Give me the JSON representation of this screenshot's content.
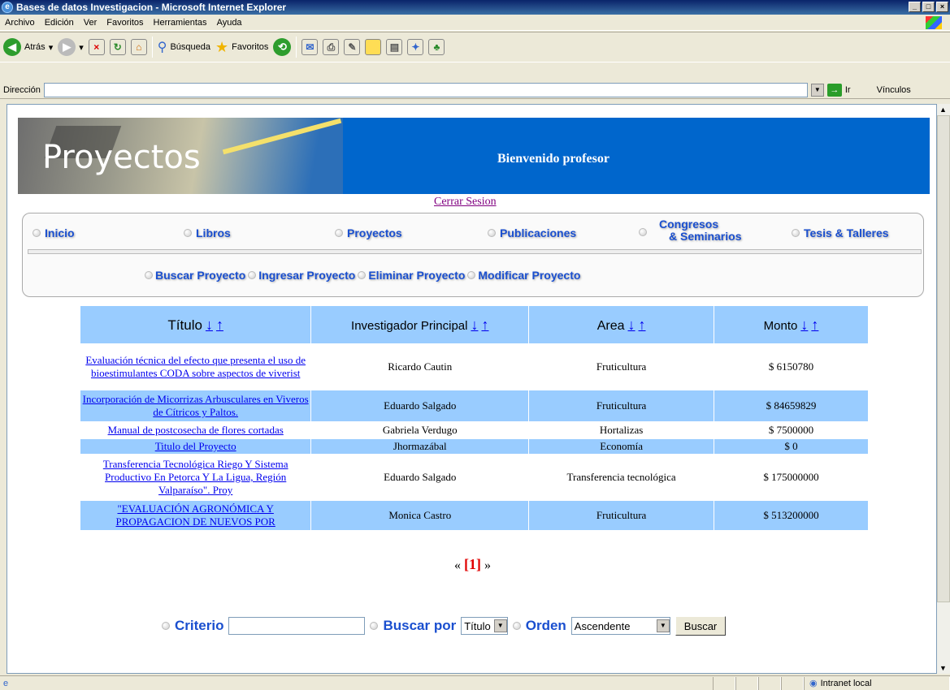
{
  "window": {
    "title": "Bases de datos Investigacion - Microsoft Internet Explorer"
  },
  "menu": [
    "Archivo",
    "Edición",
    "Ver",
    "Favoritos",
    "Herramientas",
    "Ayuda"
  ],
  "toolbar": {
    "back": "Atrás",
    "search": "Búsqueda",
    "favorites": "Favoritos"
  },
  "address": {
    "label": "Dirección",
    "value": "",
    "go": "Ir",
    "links": "Vínculos"
  },
  "banner": {
    "title": "Proyectos",
    "welcome": "Bienvenido profesor"
  },
  "logout": "Cerrar Sesion",
  "nav": {
    "main": [
      "Inicio",
      "Libros",
      "Proyectos",
      "Publicaciones",
      "Congresos",
      "& Seminarios",
      "Tesis & Talleres"
    ],
    "sub": [
      "Buscar Proyecto",
      "Ingresar Proyecto",
      "Eliminar Proyecto",
      "Modificar Proyecto"
    ]
  },
  "table": {
    "headers": [
      "Título",
      "Investigador Principal",
      "Area",
      "Monto"
    ],
    "sort_down": "↓",
    "sort_up": "↑",
    "rows": [
      {
        "titulo": "Evaluación técnica del efecto que presenta el uso de bioestimulantes CODA sobre aspectos de viverist",
        "investigador": "Ricardo Cautin",
        "area": "Fruticultura",
        "monto": "$ 6150780"
      },
      {
        "titulo": "Incorporación de Micorrizas Arbusculares en Viveros de Cítricos y Paltos.",
        "investigador": "Eduardo Salgado",
        "area": "Fruticultura",
        "monto": "$ 84659829"
      },
      {
        "titulo": "Manual de postcosecha de flores cortadas",
        "investigador": "Gabriela Verdugo",
        "area": "Hortalizas",
        "monto": "$ 7500000"
      },
      {
        "titulo": "Titulo del Proyecto",
        "investigador": "Jhormazábal",
        "area": "Economía",
        "monto": "$ 0"
      },
      {
        "titulo": "Transferencia Tecnológica Riego Y Sistema Productivo En Petorca Y La Ligua, Región Valparaíso\". Proy",
        "investigador": "Eduardo Salgado",
        "area": "Transferencia tecnológica",
        "monto": "$ 175000000"
      },
      {
        "titulo": "\"EVALUACIÓN AGRONÓMICA Y PROPAGACION DE NUEVOS POR",
        "investigador": "Monica Castro",
        "area": "Fruticultura",
        "monto": "$ 513200000"
      }
    ]
  },
  "pager": {
    "prev": "«",
    "current": "[1]",
    "next": "»"
  },
  "search": {
    "criterio_label": "Criterio",
    "criterio_value": "",
    "buscar_por_label": "Buscar por",
    "buscar_por_value": "Título",
    "orden_label": "Orden",
    "orden_value": "Ascendente",
    "button": "Buscar"
  },
  "status": {
    "zone": "Intranet local"
  }
}
